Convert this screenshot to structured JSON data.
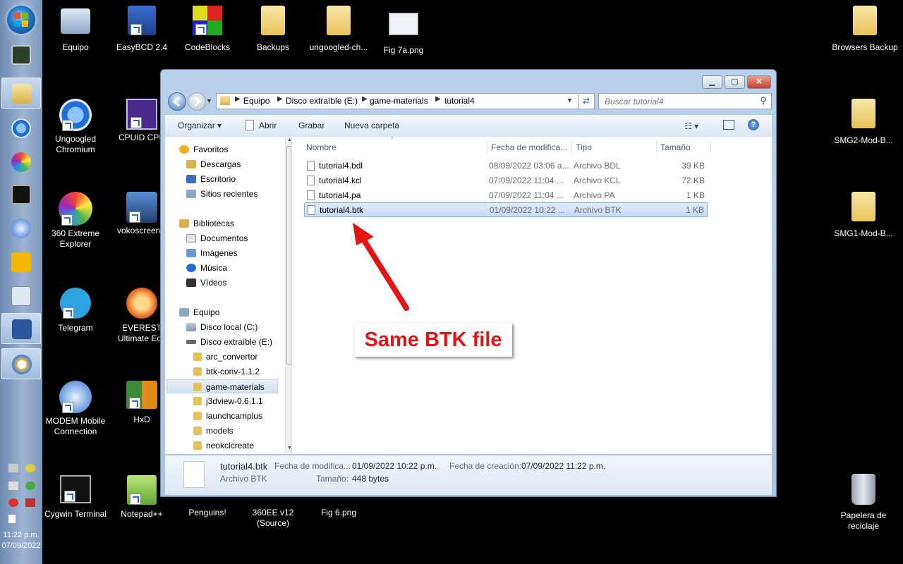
{
  "taskbar": {
    "clock_time": "11:22 p.m.",
    "clock_date": "07/09/2022"
  },
  "desktop": {
    "icons": [
      {
        "label": "Equipo"
      },
      {
        "label": "EasyBCD 2.4"
      },
      {
        "label": "CodeBlocks"
      },
      {
        "label": "Backups"
      },
      {
        "label": "ungoogled-ch..."
      },
      {
        "label": "Fig 7a.png"
      },
      {
        "label": "Browsers Backup"
      },
      {
        "label": "Ungoogled Chromium"
      },
      {
        "label": "CPUID CPU"
      },
      {
        "label": "SMG2-Mod-B..."
      },
      {
        "label": "360 Extreme Explorer"
      },
      {
        "label": "vokoscreenN"
      },
      {
        "label": "SMG1-Mod-B..."
      },
      {
        "label": "Telegram"
      },
      {
        "label": "EVEREST Ultimate Edit"
      },
      {
        "label": "MODEM Mobile Connection"
      },
      {
        "label": "HxD"
      },
      {
        "label": "Cygwin Terminal"
      },
      {
        "label": "Notepad++"
      },
      {
        "label": "Penguins!"
      },
      {
        "label": "360EE v12 (Source)"
      },
      {
        "label": "Fig 6.png"
      },
      {
        "label": "Papelera de reciclaje"
      }
    ]
  },
  "explorer": {
    "breadcrumbs": [
      "Equipo",
      "Disco extraíble (E:)",
      "game-materials",
      "tutorial4"
    ],
    "search_placeholder": "Buscar tutorial4",
    "commands": {
      "organize": "Organizar",
      "open": "Abrir",
      "burn": "Grabar",
      "new_folder": "Nueva carpeta"
    },
    "nav": {
      "favorites": "Favoritos",
      "downloads": "Descargas",
      "desktop": "Escritorio",
      "recent": "Sitios recientes",
      "libraries": "Bibliotecas",
      "documents": "Documentos",
      "images": "Imágenes",
      "music": "Música",
      "videos": "Vídeos",
      "computer": "Equipo",
      "local_disk": "Disco local (C:)",
      "removable": "Disco extraíble (E:)",
      "folders": [
        "arc_convertor",
        "btk-conv-1.1.2",
        "game-materials",
        "j3dview-0.6.1.1",
        "launchcamplus",
        "models",
        "neokclcreate"
      ]
    },
    "columns": {
      "name": "Nombre",
      "modified": "Fecha de modifica...",
      "type": "Tipo",
      "size": "Tamaño"
    },
    "files": [
      {
        "name": "tutorial4.bdl",
        "modified": "08/09/2022 03:06 a...",
        "type": "Archivo BDL",
        "size": "39 KB"
      },
      {
        "name": "tutorial4.kcl",
        "modified": "07/09/2022 11:04 ...",
        "type": "Archivo KCL",
        "size": "72 KB"
      },
      {
        "name": "tutorial4.pa",
        "modified": "07/09/2022 11:04 ...",
        "type": "Archivo PA",
        "size": "1 KB"
      },
      {
        "name": "tutorial4.btk",
        "modified": "01/09/2022 10:22 ...",
        "type": "Archivo BTK",
        "size": "1 KB"
      }
    ],
    "details": {
      "filename": "tutorial4.btk",
      "filetype": "Archivo BTK",
      "modified_label": "Fecha de modifica...",
      "modified_value": "01/09/2022 10:22 p.m.",
      "created_label": "Fecha de creación:",
      "created_value": "07/09/2022 11:22 p.m.",
      "size_label": "Tamaño:",
      "size_value": "448 bytes"
    }
  },
  "annotation": {
    "text": "Same BTK file",
    "color": "#e31414"
  }
}
